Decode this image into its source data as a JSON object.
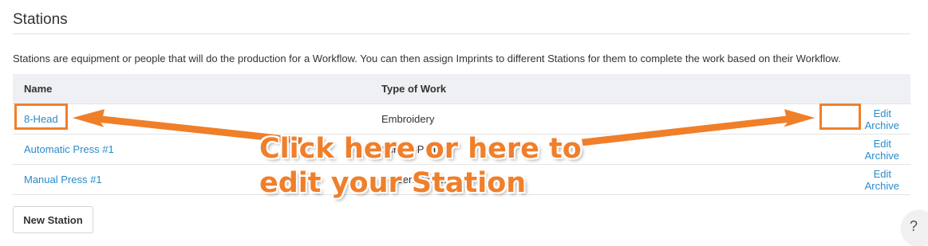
{
  "page": {
    "title": "Stations",
    "description": "Stations are equipment or people that will do the production for a Workflow. You can then assign Imprints to different Stations for them to complete the work based on their Workflow."
  },
  "table": {
    "headers": {
      "name": "Name",
      "type": "Type of Work"
    },
    "rows": [
      {
        "name": "8-Head",
        "type": "Embroidery",
        "edit": "Edit",
        "archive": "Archive"
      },
      {
        "name": "Automatic Press #1",
        "type": "Screen Printing",
        "edit": "Edit",
        "archive": "Archive"
      },
      {
        "name": "Manual Press #1",
        "type": "Screen Printing",
        "edit": "Edit",
        "archive": "Archive"
      }
    ]
  },
  "buttons": {
    "new_station": "New Station"
  },
  "annotation": {
    "line1": "Click here or here to",
    "line2": "edit your Station",
    "color": "#f07f2a"
  },
  "colors": {
    "link": "#2a8bc9",
    "header_bg": "#eef0f3"
  },
  "icons": {
    "help": "help-icon"
  }
}
